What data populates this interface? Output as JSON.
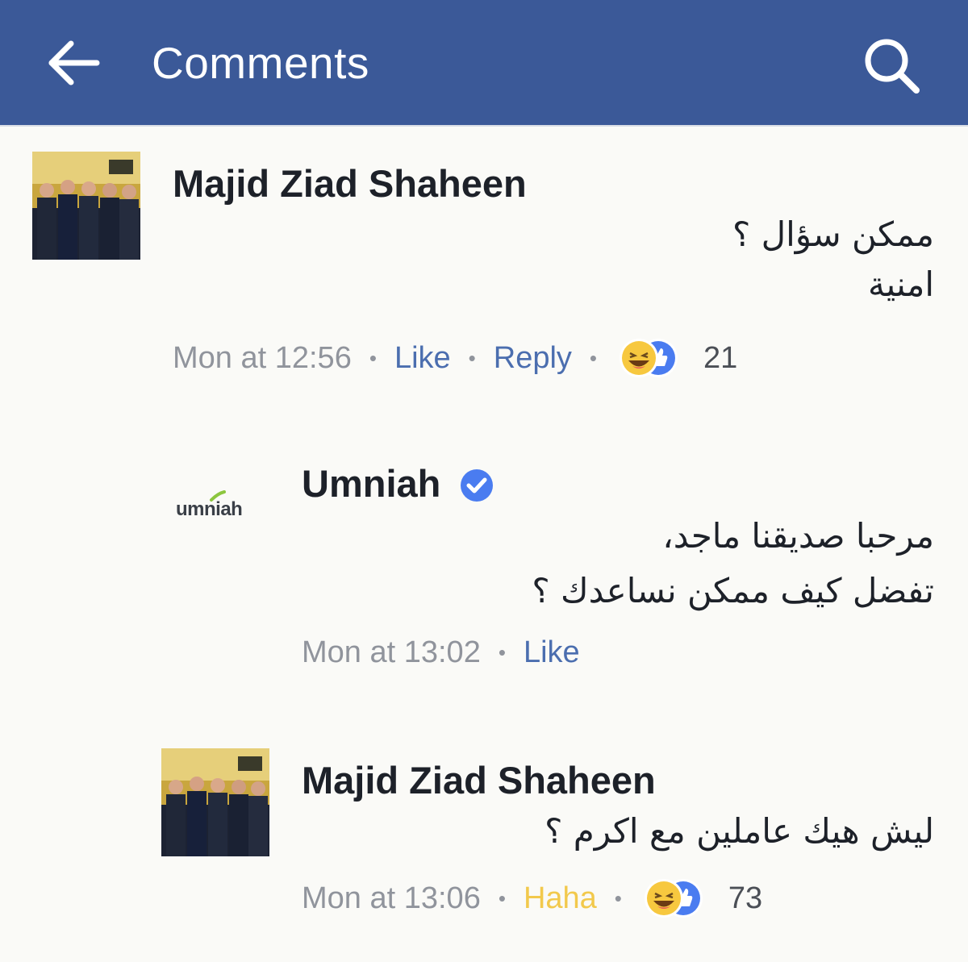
{
  "header": {
    "title": "Comments",
    "back_icon": "arrow-left-icon",
    "search_icon": "search-icon",
    "color": "#3b5998"
  },
  "comments": [
    {
      "author": "Majid Ziad Shaheen",
      "lines": [
        "ممكن سؤال ؟",
        "امنية"
      ],
      "time": "Mon at 12:56",
      "like": "Like",
      "reply": "Reply",
      "reaction_count": "21"
    },
    {
      "author": "Umniah",
      "logo_text": "umniah",
      "lines": [
        "مرحبا صديقنا ماجد،",
        "تفضل كيف ممكن نساعدك ؟"
      ],
      "time": "Mon at 13:02",
      "like": "Like"
    },
    {
      "author": "Majid Ziad Shaheen",
      "lines": [
        "ليش هيك عاملين مع اكرم ؟"
      ],
      "time": "Mon at 13:06",
      "reaction_label": "Haha",
      "reaction_count": "73"
    }
  ],
  "colors": {
    "link": "#4b6eaf",
    "meta": "#90949c",
    "haha": "#f2c94c",
    "like_blue": "#4a7cf0"
  }
}
